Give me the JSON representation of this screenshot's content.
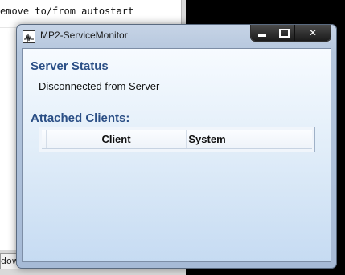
{
  "background_window": {
    "text": "emove to/from autostart",
    "status_text": "dow"
  },
  "window": {
    "title": "MP2-ServiceMonitor",
    "icon": "app-icon",
    "buttons": {
      "minimize_icon": "minimize-icon",
      "maximize_icon": "maximize-icon",
      "close_label": "✕"
    }
  },
  "server": {
    "title": "Server Status",
    "status": "Disconnected from Server"
  },
  "clients": {
    "title": "Attached Clients:",
    "columns": [
      "Client",
      "System"
    ],
    "rows": []
  },
  "colors": {
    "section_title": "#2b4f86"
  }
}
